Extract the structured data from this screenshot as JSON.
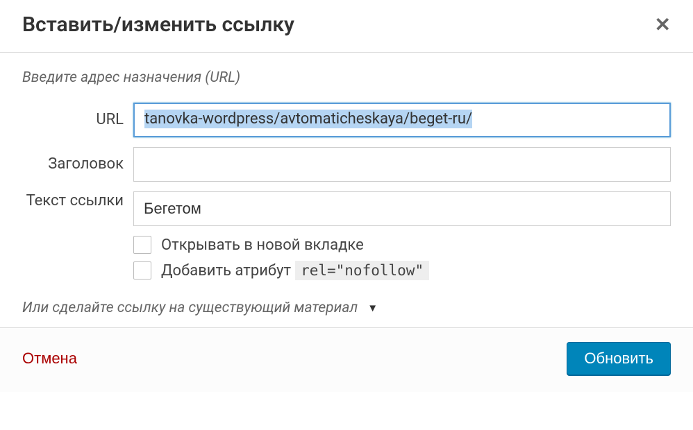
{
  "dialog": {
    "title": "Вставить/изменить ссылку",
    "intro": "Введите адрес назначения (URL)"
  },
  "fields": {
    "url": {
      "label": "URL",
      "value": "tanovka-wordpress/avtomaticheskaya/beget-ru/"
    },
    "title": {
      "label": "Заголовок",
      "value": ""
    },
    "linktext": {
      "label": "Текст ссылки",
      "value": "Бегетом"
    }
  },
  "checkboxes": {
    "newtab": "Открывать в новой вкладке",
    "nofollow_prefix": "Добавить атрибут",
    "nofollow_code": "rel=\"nofollow\""
  },
  "expand": {
    "label": "Или сделайте ссылку на существующий материал"
  },
  "footer": {
    "cancel": "Отмена",
    "submit": "Обновить"
  }
}
